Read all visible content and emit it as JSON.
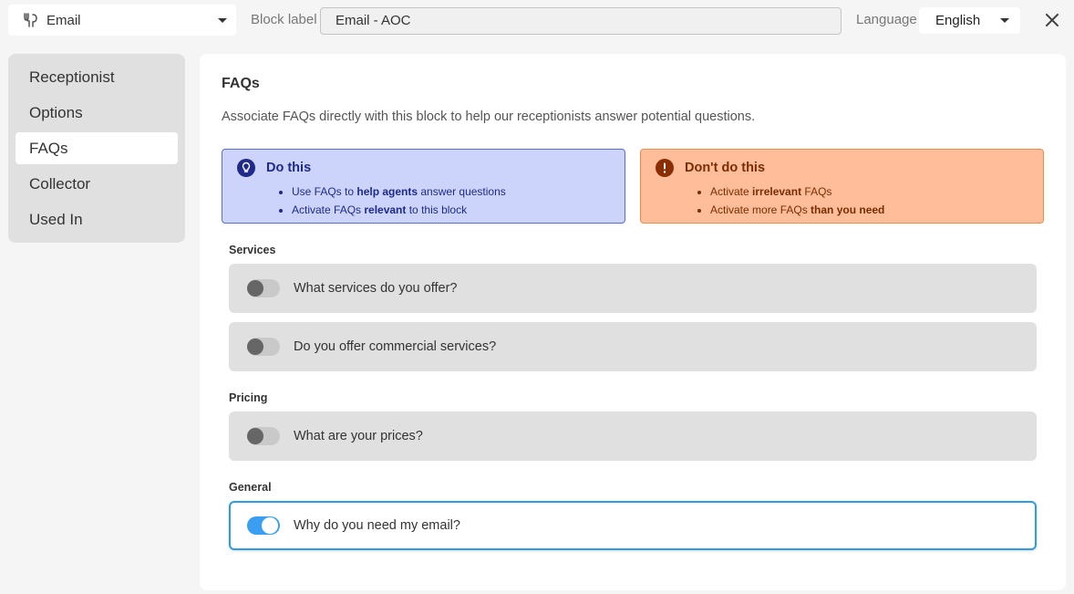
{
  "topbar": {
    "type_select": {
      "value": "Email",
      "icon": "tool-icon"
    },
    "block_label": {
      "label": "Block label",
      "value": "Email - AOC"
    },
    "language": {
      "label": "Language",
      "value": "English"
    },
    "close_icon": "close-icon"
  },
  "sidebar": {
    "items": [
      {
        "label": "Receptionist",
        "active": false
      },
      {
        "label": "Options",
        "active": false
      },
      {
        "label": "FAQs",
        "active": true
      },
      {
        "label": "Collector",
        "active": false
      },
      {
        "label": "Used In",
        "active": false
      }
    ]
  },
  "main": {
    "title": "FAQs",
    "description": "Associate FAQs directly with this block to help our receptionists answer potential questions.",
    "do_tip": {
      "title": "Do this",
      "icon": "lightbulb-icon",
      "items": [
        {
          "pre": "Use FAQs to ",
          "bold": "help agents",
          "post": " answer questions"
        },
        {
          "pre": "Activate FAQs ",
          "bold": "relevant",
          "post": " to this block"
        }
      ]
    },
    "dont_tip": {
      "title": "Don't do this",
      "icon": "alert-icon",
      "items": [
        {
          "pre": "Activate ",
          "bold": "irrelevant",
          "post": " FAQs"
        },
        {
          "pre": "Activate more FAQs ",
          "bold": "than you need",
          "post": ""
        }
      ]
    },
    "groups": [
      {
        "label": "Services",
        "faqs": [
          {
            "question": "What services do you offer?",
            "enabled": false
          },
          {
            "question": "Do you offer commercial services?",
            "enabled": false
          }
        ]
      },
      {
        "label": "Pricing",
        "faqs": [
          {
            "question": "What are your prices?",
            "enabled": false
          }
        ]
      },
      {
        "label": "General",
        "faqs": [
          {
            "question": "Why do you need my email?",
            "enabled": true
          }
        ]
      }
    ]
  },
  "colors": {
    "accent": "#3b9ef0",
    "do_bg": "#cdd4fc",
    "dont_bg": "#ffbe99"
  }
}
